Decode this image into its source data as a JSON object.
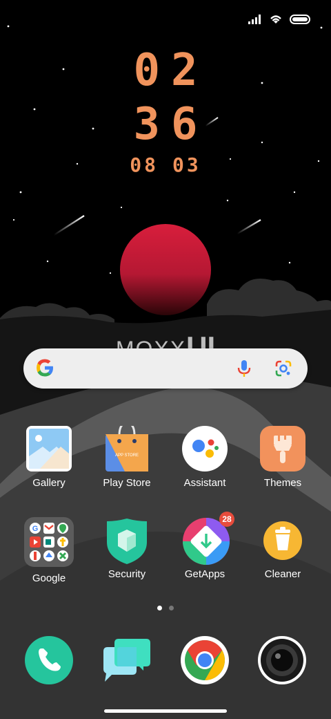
{
  "clock": {
    "hour": "02",
    "minute": "36",
    "date_month": "08",
    "date_day": "03"
  },
  "brand": {
    "part1": "MOXX",
    "part2": "UI"
  },
  "search": {
    "g_icon": "google-g-icon",
    "mic_icon": "microphone-icon",
    "lens_icon": "google-lens-icon"
  },
  "apps": {
    "gallery": "Gallery",
    "play_store": "Play Store",
    "play_store_bag_text": "APP STORE",
    "assistant": "Assistant",
    "themes": "Themes",
    "google": "Google",
    "security": "Security",
    "getapps": "GetApps",
    "getapps_badge": "28",
    "cleaner": "Cleaner"
  },
  "dock": [
    "phone-icon",
    "messages-icon",
    "chrome-icon",
    "camera-icon"
  ],
  "pages": {
    "count": 2,
    "active": 1
  },
  "colors": {
    "clock": "#f0935c",
    "sun": "#d81e3c",
    "accent": "#1fcfb0"
  }
}
